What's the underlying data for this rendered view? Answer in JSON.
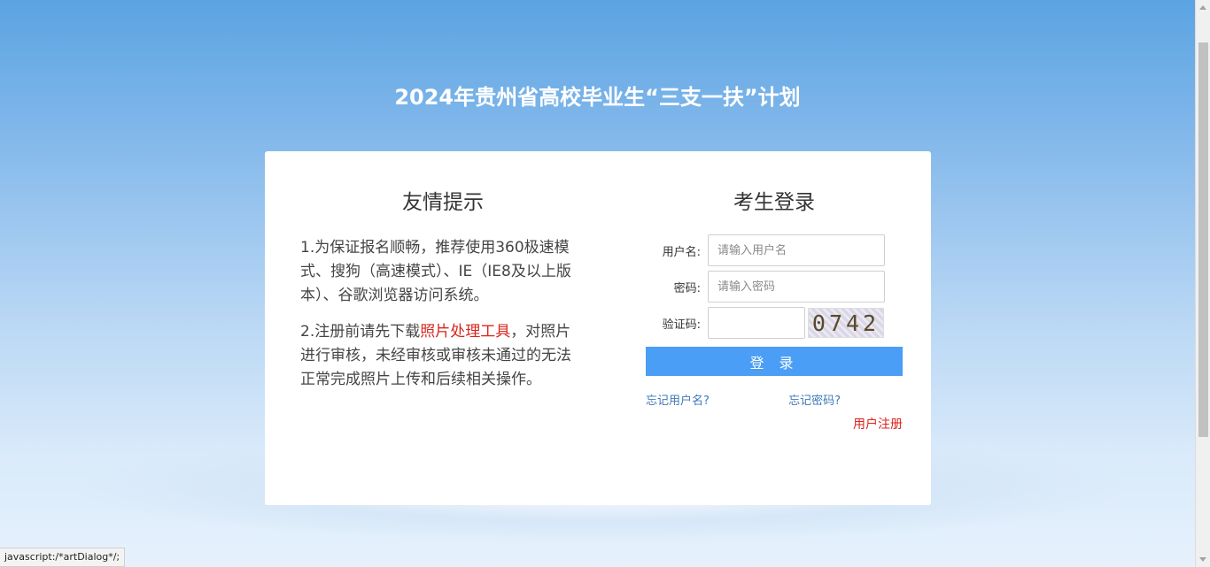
{
  "page": {
    "title": "2024年贵州省高校毕业生“三支一扶”计划"
  },
  "tips": {
    "title": "友情提示",
    "item1": "1.为保证报名顺畅，推荐使用360极速模式、搜狗（高速模式）、IE（IE8及以上版本）、谷歌浏览器访问系统。",
    "item2_prefix": "2.注册前请先下载",
    "item2_link": "照片处理工具",
    "item2_suffix": "，对照片进行审核，未经审核或审核未通过的无法正常完成照片上传和后续相关操作。"
  },
  "login": {
    "title": "考生登录",
    "username_label": "用户名:",
    "username_placeholder": "请输入用户名",
    "password_label": "密码:",
    "password_placeholder": "请输入密码",
    "captcha_label": "验证码:",
    "captcha_text": "0742",
    "submit_label": "登 录",
    "forgot_username": "忘记用户名?",
    "forgot_password": "忘记密码?",
    "register": "用户注册"
  },
  "status_bar": {
    "text": "javascript:/*artDialog*/;"
  }
}
